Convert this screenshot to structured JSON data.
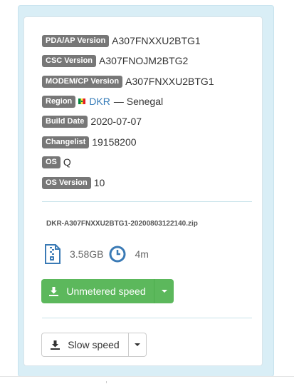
{
  "firmware": {
    "rows": [
      {
        "label": "PDA/AP Version",
        "value": "A307FNXXU2BTG1"
      },
      {
        "label": "CSC Version",
        "value": "A307FNOJM2BTG2"
      },
      {
        "label": "MODEM/CP Version",
        "value": "A307FNXXU2BTG1"
      },
      {
        "label": "Region",
        "value": "DKR",
        "suffix": "— Senegal"
      },
      {
        "label": "Build Date",
        "value": "2020-07-07"
      },
      {
        "label": "Changelist",
        "value": "19158200"
      },
      {
        "label": "OS",
        "value": "Q"
      },
      {
        "label": "OS Version",
        "value": "10"
      }
    ]
  },
  "download": {
    "filename": "DKR-A307FNXXU2BTG1-20200803122140.zip",
    "size": "3.58GB",
    "time": "4m",
    "primary_label": "Unmetered speed",
    "secondary_label": "Slow speed"
  },
  "colors": {
    "badge": "#777777",
    "success": "#5cb85c",
    "link": "#337ab7",
    "panel": "#d9eef6",
    "icon": "#3a7ab5"
  },
  "icons": {
    "file": "zip-file-icon",
    "clock": "clock-icon",
    "download": "download-icon",
    "flag": "senegal-flag-icon"
  }
}
